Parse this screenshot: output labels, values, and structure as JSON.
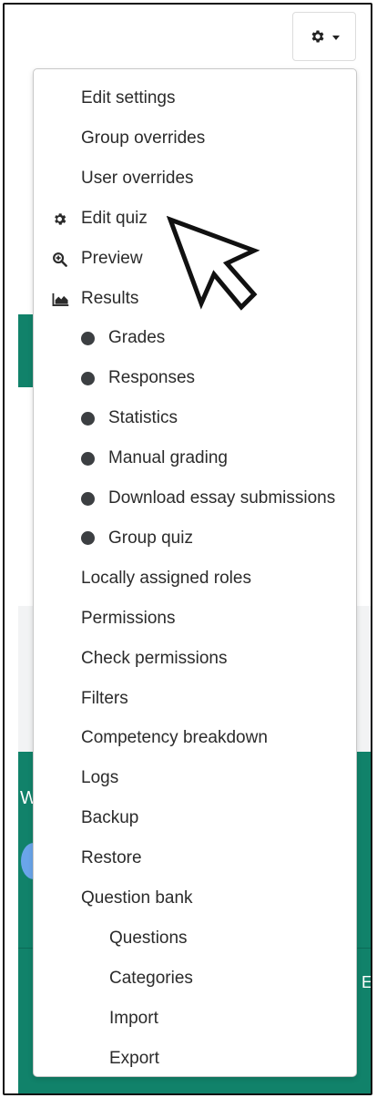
{
  "header": {
    "settings_icon": "gear-icon",
    "dropdown_icon": "caret-down-icon"
  },
  "menu": {
    "items": [
      {
        "label": "Edit settings",
        "level": 0
      },
      {
        "label": "Group overrides",
        "level": 0
      },
      {
        "label": "User overrides",
        "level": 0
      },
      {
        "label": "Edit quiz",
        "level": 0,
        "icon": "gear-icon"
      },
      {
        "label": "Preview",
        "level": 0,
        "icon": "zoom-in-icon"
      },
      {
        "label": "Results",
        "level": 0,
        "icon": "area-chart-icon"
      },
      {
        "label": "Grades",
        "level": 1,
        "bullet": true
      },
      {
        "label": "Responses",
        "level": 1,
        "bullet": true
      },
      {
        "label": "Statistics",
        "level": 1,
        "bullet": true
      },
      {
        "label": "Manual grading",
        "level": 1,
        "bullet": true
      },
      {
        "label": "Download essay submissions",
        "level": 1,
        "bullet": true
      },
      {
        "label": "Group quiz",
        "level": 1,
        "bullet": true
      },
      {
        "label": "Locally assigned roles",
        "level": 0
      },
      {
        "label": "Permissions",
        "level": 0
      },
      {
        "label": "Check permissions",
        "level": 0
      },
      {
        "label": "Filters",
        "level": 0
      },
      {
        "label": "Competency breakdown",
        "level": 0
      },
      {
        "label": "Logs",
        "level": 0
      },
      {
        "label": "Backup",
        "level": 0
      },
      {
        "label": "Restore",
        "level": 0
      },
      {
        "label": "Question bank",
        "level": 0
      },
      {
        "label": "Questions",
        "level": 1
      },
      {
        "label": "Categories",
        "level": 1
      },
      {
        "label": "Import",
        "level": 1
      },
      {
        "label": "Export",
        "level": 1
      }
    ]
  },
  "background": {
    "edge_letter_left": "W",
    "edge_letter_right": "E"
  },
  "colors": {
    "accent": "#11826a",
    "bullet": "#3c3f42"
  }
}
